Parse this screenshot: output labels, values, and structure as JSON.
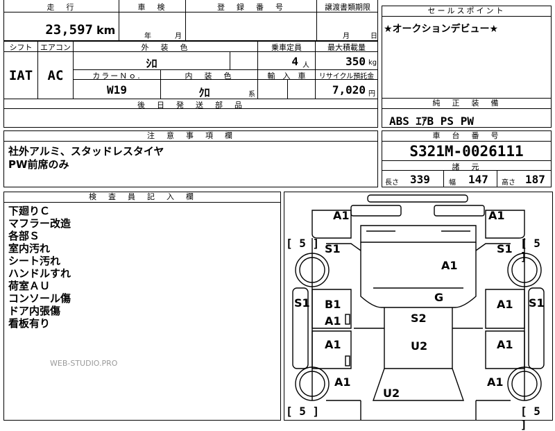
{
  "top_row": {
    "mileage_label": "走　行",
    "mileage_value": "23,597",
    "mileage_unit": "km",
    "inspection_label": "車　検",
    "inspection_year": "年",
    "inspection_month": "月",
    "registration_label": "登　録　番　号",
    "transfer_label": "譲渡書類期限",
    "transfer_month": "月",
    "transfer_day": "日"
  },
  "spec_row": {
    "shift_label": "シフト",
    "shift_value": "IAT",
    "ac_label": "エアコン",
    "ac_value": "AC",
    "exterior_color_label": "外　装　色",
    "exterior_color_value": "ｼﾛ",
    "seating_label": "乗車定員",
    "seating_value": "4",
    "seating_unit": "人",
    "max_load_label": "最大積載量",
    "max_load_value": "350",
    "max_load_unit": "kg",
    "color_no_label": "カラーＮｏ.",
    "color_no_value": "W19",
    "interior_color_label": "内　装　色",
    "interior_color_value": "ｸﾛ",
    "interior_suffix": "系",
    "import_label": "輸　入　車",
    "recycle_label": "リサイクル預託金",
    "recycle_value": "7,020",
    "recycle_unit": "円",
    "later_parts_label": "後　日　発　送　部　品"
  },
  "sales_point": {
    "label": "セールスポイント",
    "text": "★オークションデビュー★"
  },
  "standard_equipment": {
    "label": "純　正　装　備",
    "text": "ABS ｴｱB PS PW"
  },
  "caution": {
    "label": "注　意　事　項　欄",
    "lines": [
      "社外アルミ、スタッドレスタイヤ",
      "PW前席のみ"
    ]
  },
  "chassis": {
    "label": "車　台　番　号",
    "value": "S321M-0026111",
    "spec_label": "諸　元",
    "length_label": "長さ",
    "length_value": "339",
    "width_label": "幅",
    "width_value": "147",
    "height_label": "高さ",
    "height_value": "187"
  },
  "inspector": {
    "label": "検　査　員　記　入　欄",
    "lines": [
      "下廻りＣ",
      "マフラー改造",
      "各部Ｓ",
      "室内汚れ",
      "シート汚れ",
      "ハンドルすれ",
      "荷室ＡＵ",
      "コンソール傷",
      "ドア内張傷",
      "看板有り"
    ]
  },
  "diagram": {
    "marks": [
      "A1",
      "A1",
      "S1",
      "S1",
      "A1",
      "S1",
      "B1",
      "A1",
      "G",
      "A1",
      "S1",
      "S2",
      "A1",
      "A1",
      "U2",
      "A1",
      "A1",
      "A1",
      "U2"
    ],
    "tire_marks": [
      "[ 5 ]",
      "[ 5 ]",
      "[ 5 ]",
      "[ 5 ]"
    ]
  },
  "watermark": "WEB-STUDIO.PRO"
}
